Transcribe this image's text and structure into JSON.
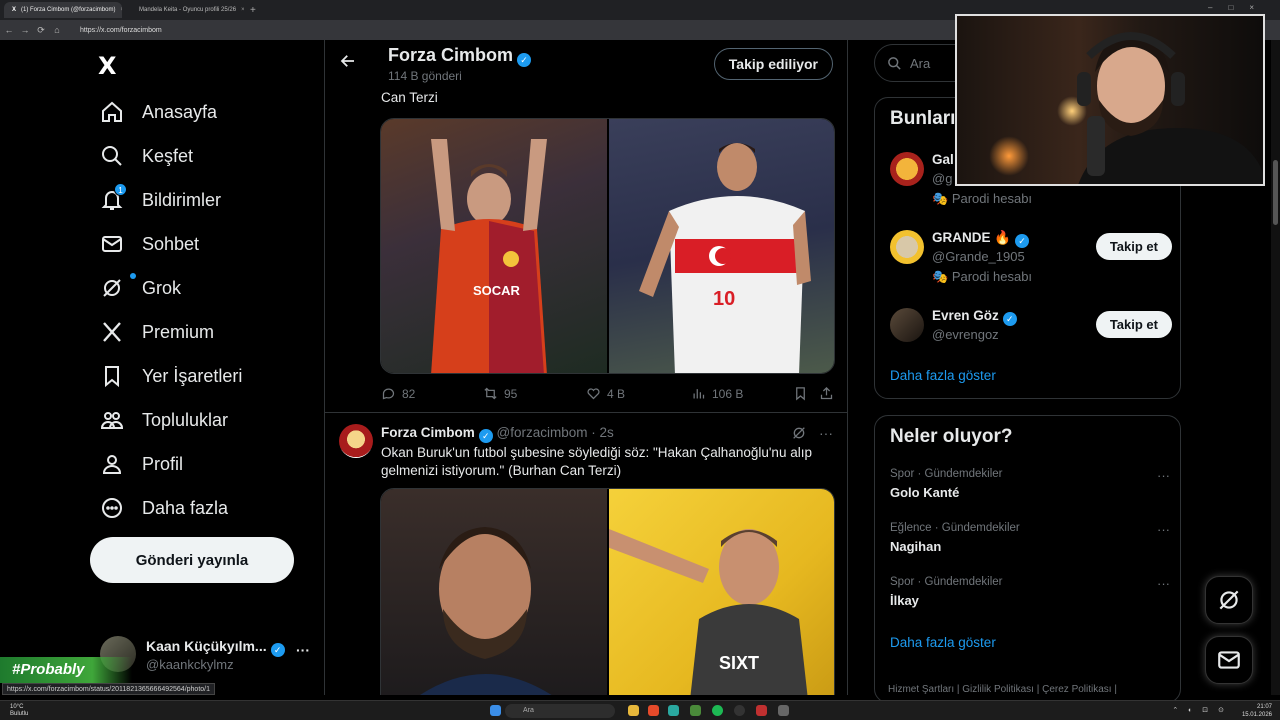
{
  "browser": {
    "tabs": [
      {
        "title": "(1) Forza Cimbom (@forzacimbom)",
        "close": "×"
      },
      {
        "title": "Mandela Keita - Oyuncu profili 25/26",
        "close": "×"
      }
    ],
    "new_tab": "+",
    "window_controls": "–□×",
    "nav": {
      "back": "←",
      "forward": "→",
      "reload": "⟳",
      "home": "⌂"
    },
    "url": "https://x.com/forzacimbom",
    "status_url": "https://x.com/forzacimbom/status/2011821365666492564/photo/1"
  },
  "sidebar": {
    "logo": "X",
    "items": [
      {
        "label": "Anasayfa",
        "icon": "home-icon"
      },
      {
        "label": "Keşfet",
        "icon": "search-icon"
      },
      {
        "label": "Bildirimler",
        "icon": "bell-icon",
        "badge": "1"
      },
      {
        "label": "Sohbet",
        "icon": "mail-icon"
      },
      {
        "label": "Grok",
        "icon": "grok-icon"
      },
      {
        "label": "Premium",
        "icon": "x-icon"
      },
      {
        "label": "Yer İşaretleri",
        "icon": "bookmark-icon"
      },
      {
        "label": "Topluluklar",
        "icon": "communities-icon"
      },
      {
        "label": "Profil",
        "icon": "person-icon"
      },
      {
        "label": "Daha fazla",
        "icon": "more-circle-icon"
      }
    ],
    "post_button": "Gönderi yayınla",
    "account": {
      "name": "Kaan Küçükyılm...",
      "handle": "@kaankckylmz",
      "more": "···"
    }
  },
  "profile_header": {
    "title": "Forza Cimbom",
    "subtitle": "114 B gönderi",
    "follow_button": "Takip ediliyor"
  },
  "tweets": [
    {
      "text_tail": "Can Terzi",
      "actions": {
        "replies": "82",
        "retweets": "95",
        "likes": "4 B",
        "views": "106 B"
      }
    },
    {
      "author": "Forza Cimbom",
      "handle": "@forzacimbom",
      "time": "2s",
      "text": "Okan Buruk'un futbol şubesine söylediği söz: \"Hakan Çalhanoğlu'nu alıp gelmenizi istiyorum.\" (Burhan Can Terzi)",
      "more": "···"
    }
  ],
  "right": {
    "search_placeholder": "Ara",
    "who_to_follow": {
      "title": "Bunları",
      "accounts": [
        {
          "name": "Gal",
          "handle": "@g",
          "note": "Parodi hesabı"
        },
        {
          "name": "GRANDE 🔥",
          "handle": "@Grande_1905",
          "note": "Parodi hesabı",
          "button": "Takip et"
        },
        {
          "name": "Evren Göz",
          "handle": "@evrengoz",
          "button": "Takip et"
        }
      ],
      "show_more": "Daha fazla göster"
    },
    "trends": {
      "title": "Neler oluyor?",
      "items": [
        {
          "category": "Spor · Gündemdekiler",
          "name": "Golo Kanté"
        },
        {
          "category": "Eğlence · Gündemdekiler",
          "name": "Nagihan"
        },
        {
          "category": "Spor · Gündemdekiler",
          "name": "İlkay"
        }
      ],
      "show_more": "Daha fazla göster",
      "more": "···"
    },
    "footer": "Hizmet Şartları  |  Gizlilik Politikası  |  Çerez Politikası  |"
  },
  "overlay": {
    "probably": "#Probably"
  },
  "taskbar": {
    "weather_temp": "10°C",
    "weather_desc": "Bulutlu",
    "search": "Ara",
    "time": "21:07",
    "date": "15.01.2026",
    "tray": "⌃ ◐ ⊡ ⊙"
  },
  "colors": {
    "accent": "#1d9bf0",
    "bg": "#000000",
    "border": "#2f3336",
    "muted": "#71767b"
  }
}
